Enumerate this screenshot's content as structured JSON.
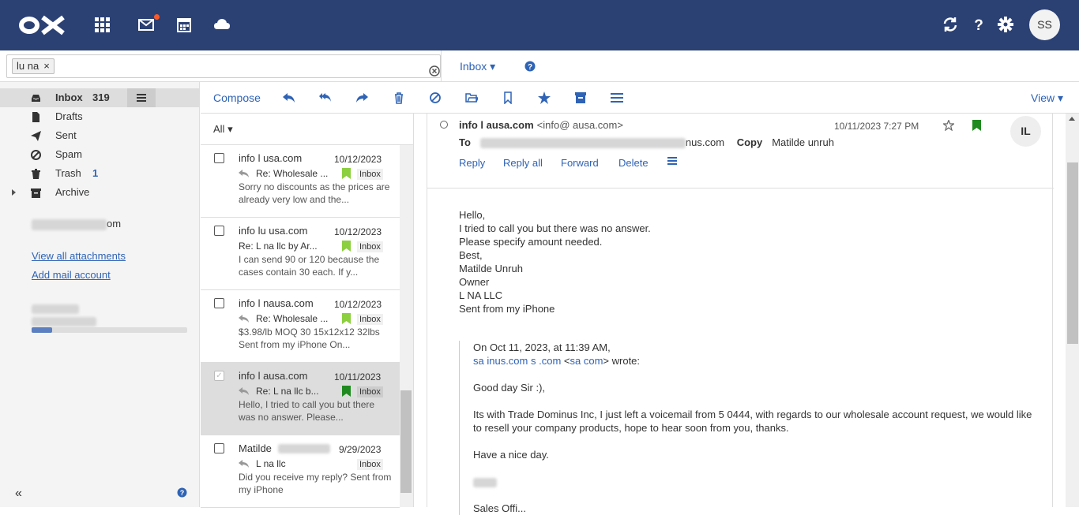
{
  "topbar": {
    "avatar": "SS",
    "colors": {
      "bar": "#2b4174",
      "notification": "#ff5a26",
      "link": "#2f63b5"
    },
    "icons": [
      "apps-grid-icon",
      "mail-icon",
      "calendar-icon",
      "cloud-icon",
      "refresh-icon",
      "help-icon",
      "gear-icon"
    ]
  },
  "search": {
    "token": "lu  na",
    "token_remove": "×"
  },
  "folder_select": {
    "label": "Inbox"
  },
  "sidebar": {
    "folders": [
      {
        "label": "Inbox",
        "count": "319"
      },
      {
        "label": "Drafts",
        "count": ""
      },
      {
        "label": "Sent",
        "count": ""
      },
      {
        "label": "Spam",
        "count": ""
      },
      {
        "label": "Trash",
        "count": "1"
      },
      {
        "label": "Archive",
        "count": ""
      }
    ],
    "account_suffix": "om",
    "view_attachments": "View all attachments",
    "add_account": "Add mail account",
    "collapse": "«"
  },
  "toolbar": {
    "compose": "Compose",
    "view": "View"
  },
  "list": {
    "filter": "All",
    "mails": [
      {
        "from": "info l       usa.com",
        "date": "10/12/2023",
        "subject": "Re: Wholesale ...",
        "tag": "Inbox",
        "preview": "Sorry no discounts as the prices are already very low and the..."
      },
      {
        "from": "info lu        usa.com",
        "date": "10/12/2023",
        "subject": "Re: L    na llc by Ar...",
        "tag": "Inbox",
        "preview": "I can send 90 or 120 because the cases contain 30 each. If y..."
      },
      {
        "from": "info l       nausa.com",
        "date": "10/12/2023",
        "subject": "Re: Wholesale ...",
        "tag": "Inbox",
        "preview": "$3.98/lb MOQ 30 15x12x12 32lbs Sent from my iPhone On..."
      },
      {
        "from": "info l       ausa.com",
        "date": "10/11/2023",
        "subject": "Re: L    na llc b...",
        "tag": "Inbox",
        "preview": "Hello, I tried to call you but there was no answer. Please..."
      },
      {
        "from": "Matilde",
        "date": "9/29/2023",
        "subject": "L    na llc",
        "tag": "Inbox",
        "preview": "Did you receive my reply? Sent from my iPhone"
      }
    ]
  },
  "message": {
    "from_name": "info l       ausa.com",
    "from_addr": "<info@        ausa.com>",
    "date": "10/11/2023 7:27 PM",
    "avatar": "IL",
    "to_label": "To",
    "to_value": "nus.com",
    "copy_label": "Copy",
    "copy_value": "Matilde                    unruh",
    "actions": [
      "Reply",
      "Reply all",
      "Forward",
      "Delete"
    ],
    "body": [
      "Hello,",
      "I tried to call you but there was no answer.",
      "Please specify amount needed.",
      "Best,",
      "Matilde                 Unruh",
      "Owner",
      "L     NA LLC",
      "Sent from my iPhone"
    ],
    "quote": {
      "header": "On Oct 11, 2023, at 11:39 AM,",
      "addr1": "sa                     inus.com",
      "addr2": "s                          .com",
      "addr3": "sa                          com",
      "wrote": "> wrote:",
      "lines": [
        "Good day Sir :),",
        "Its         with Trade Dominus Inc, I just left a voicemail from 5              0444, with regards to our wholesale account request, we would like to resell your company products, hope to hear soon from you, thanks.",
        "Have a nice day.",
        "",
        "Sales Offi..."
      ]
    }
  }
}
